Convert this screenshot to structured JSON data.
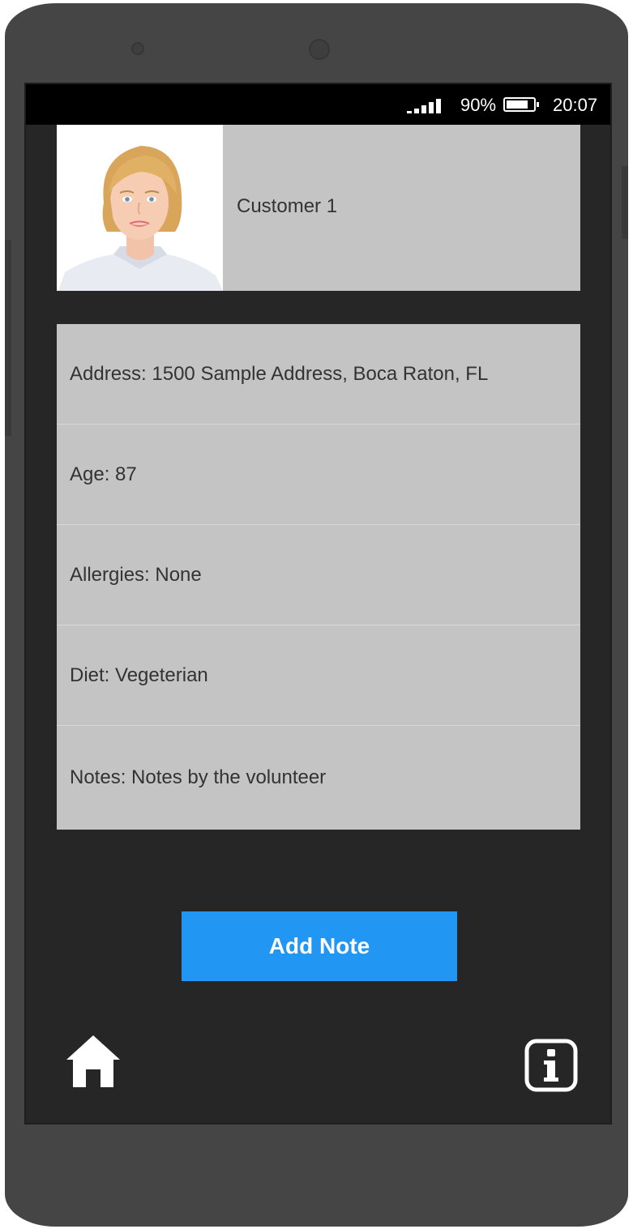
{
  "status_bar": {
    "battery_percent": "90%",
    "battery_level": 0.8,
    "time": "20:07",
    "signal_bars": 5
  },
  "customer": {
    "name": "Customer 1",
    "avatar": "avatar-photo"
  },
  "details": [
    {
      "text": "Address: 1500 Sample Address, Boca Raton, FL"
    },
    {
      "text": "Age: 87"
    },
    {
      "text": "Allergies: None"
    },
    {
      "text": "Diet: Vegeterian"
    },
    {
      "text": "Notes: Notes by the volunteer"
    }
  ],
  "actions": {
    "add_note_label": "Add Note"
  },
  "nav": {
    "home_icon": "home-icon",
    "info_icon": "info-icon"
  },
  "colors": {
    "accent": "#2196f3",
    "card_bg": "#c4c4c4",
    "screen_bg": "#262626",
    "device_body": "#454545"
  }
}
